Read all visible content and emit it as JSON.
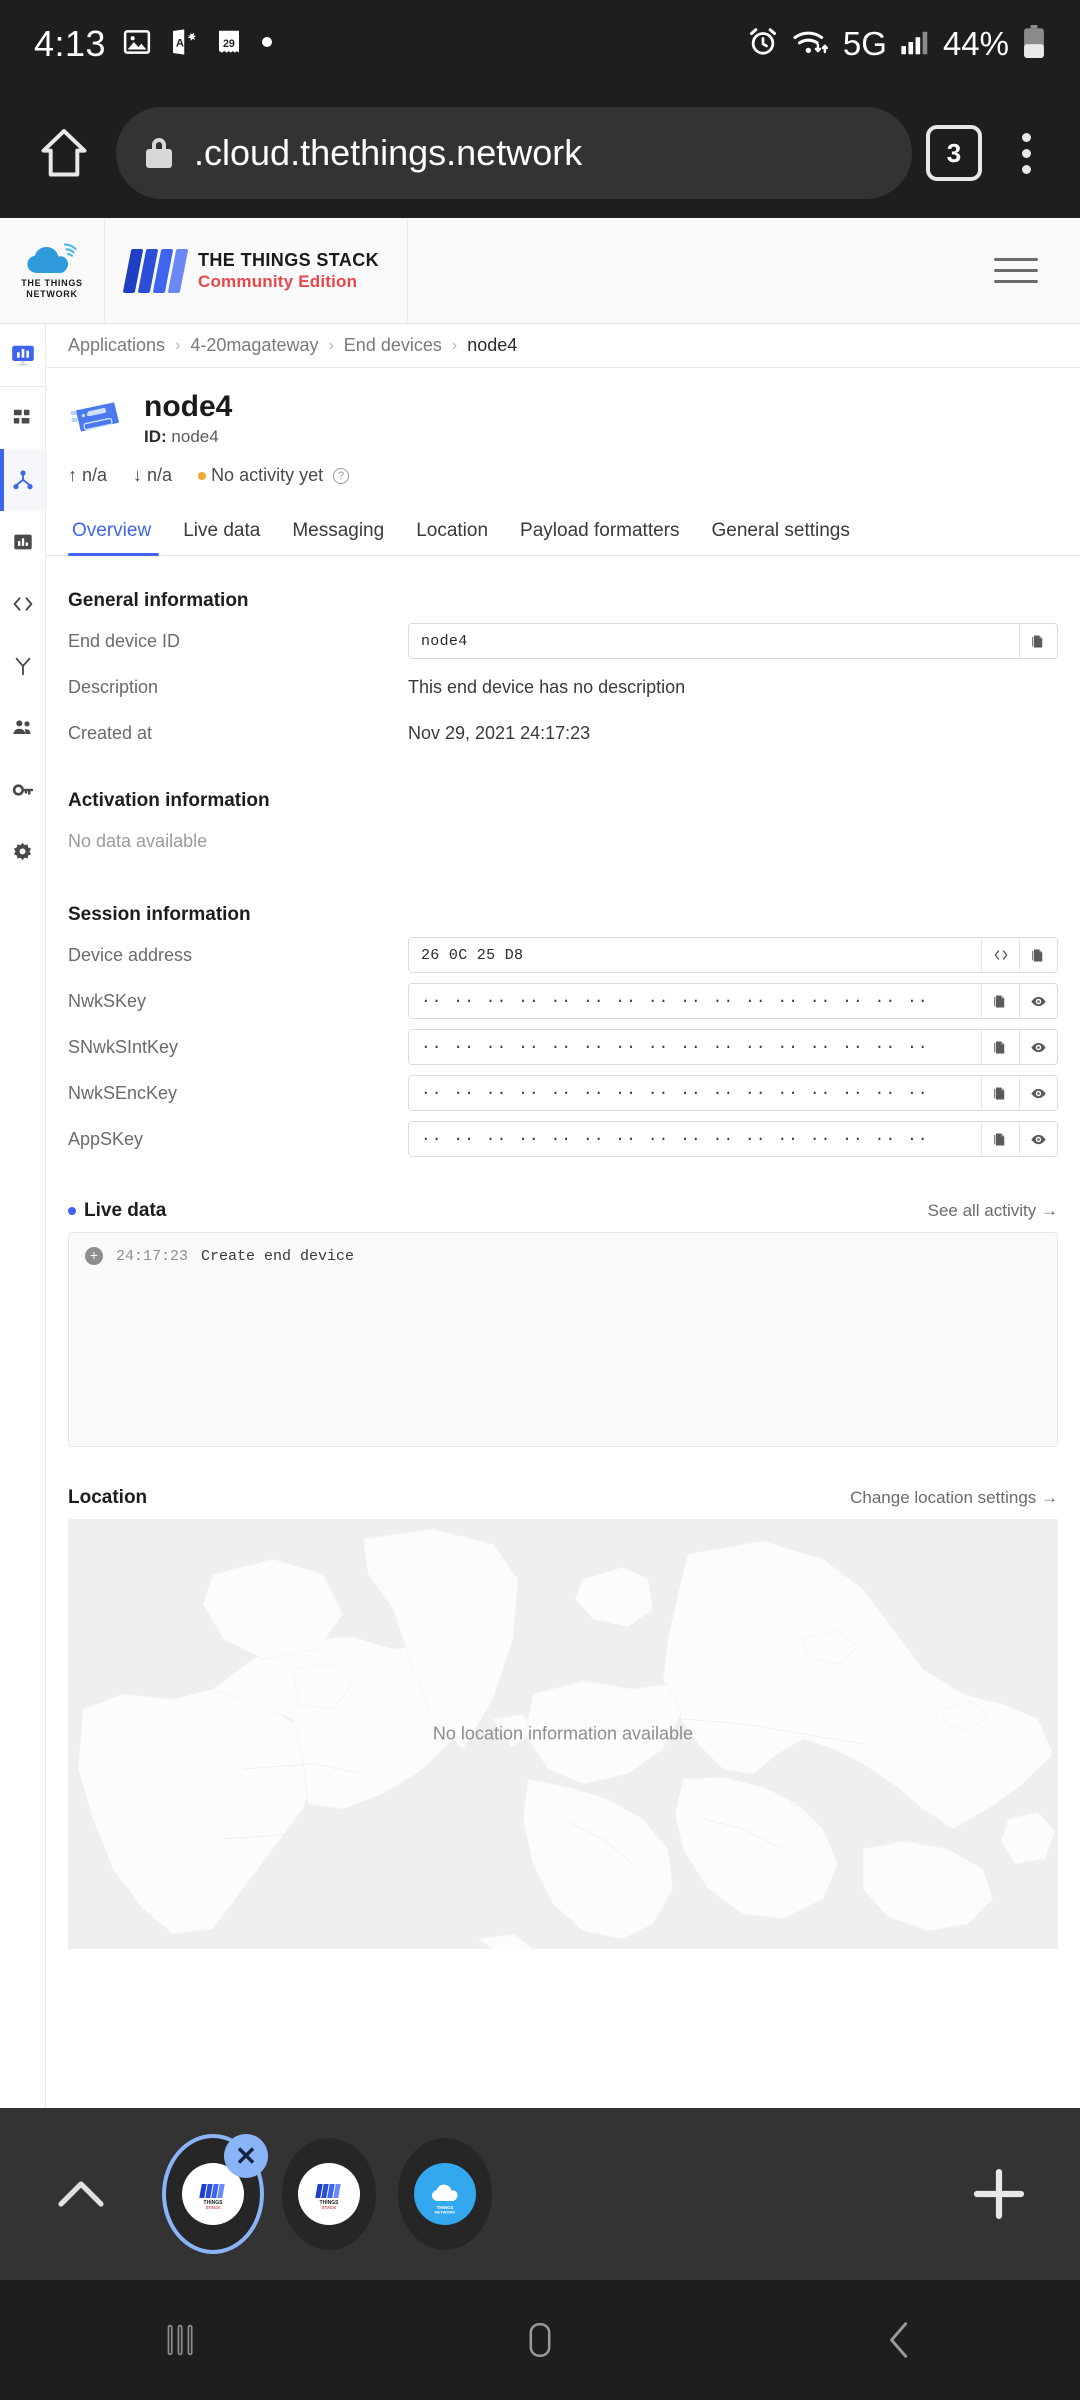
{
  "status_bar": {
    "clock": "4:13",
    "network_label": "5G",
    "battery_pct": "44%",
    "icons": [
      "photo-icon",
      "translate-icon",
      "calendar-29-icon",
      "dot-icon",
      "alarm-icon",
      "wifi-icon",
      "signal-icon",
      "battery-icon"
    ]
  },
  "browser": {
    "url": ".cloud.thethings.network",
    "tab_count": "3",
    "home_icon": "home-icon",
    "lock_icon": "lock-icon",
    "menu_icon": "kebab-menu-icon"
  },
  "app_header": {
    "ttn_wordmark_line1": "THE THINGS",
    "ttn_wordmark_line2": "NETWORK",
    "stack_title": "THE THINGS STACK",
    "stack_subtitle": "Community Edition",
    "stack_subtitle_color": "#e8474b",
    "menu_icon": "hamburger-menu-icon"
  },
  "sidebar": {
    "items": [
      {
        "name": "overview-icon",
        "active": false
      },
      {
        "name": "applications-grid-icon",
        "active": false
      },
      {
        "name": "end-devices-icon",
        "active": true
      },
      {
        "name": "live-data-icon",
        "active": false
      },
      {
        "name": "payload-formatters-icon",
        "active": false
      },
      {
        "name": "integrations-icon",
        "active": false
      },
      {
        "name": "collaborators-icon",
        "active": false
      },
      {
        "name": "api-keys-icon",
        "active": false
      },
      {
        "name": "general-settings-icon",
        "active": false
      }
    ]
  },
  "breadcrumb": {
    "items": [
      "Applications",
      "4-20magateway",
      "End devices",
      "node4"
    ],
    "separator": "›"
  },
  "device": {
    "name": "node4",
    "id_label": "ID:",
    "id_value": "node4",
    "uplink": "n/a",
    "downlink": "n/a",
    "activity": "No activity yet",
    "up_arrow": "↑",
    "down_arrow": "↓",
    "status_color": "#f0a830",
    "help_icon": "question-mark-icon"
  },
  "tabs": [
    {
      "label": "Overview",
      "active": true
    },
    {
      "label": "Live data",
      "active": false
    },
    {
      "label": "Messaging",
      "active": false
    },
    {
      "label": "Location",
      "active": false
    },
    {
      "label": "Payload formatters",
      "active": false
    },
    {
      "label": "General settings",
      "active": false
    }
  ],
  "general_information": {
    "title": "General information",
    "rows": [
      {
        "label": "End device ID",
        "value": "node4",
        "type": "field",
        "buttons": [
          "copy-icon"
        ]
      },
      {
        "label": "Description",
        "value": "This end device has no description",
        "type": "text"
      },
      {
        "label": "Created at",
        "value": "Nov 29, 2021 24:17:23",
        "type": "text"
      }
    ]
  },
  "activation_information": {
    "title": "Activation information",
    "empty_text": "No data available"
  },
  "session_information": {
    "title": "Session information",
    "rows": [
      {
        "label": "Device address",
        "value": "26 0C 25 D8",
        "masked": false,
        "buttons": [
          "code-icon",
          "copy-icon"
        ]
      },
      {
        "label": "NwkSKey",
        "value": "·· ·· ·· ·· ·· ·· ·· ·· ·· ·· ·· ·· ·· ·· ·· ··",
        "masked": true,
        "buttons": [
          "copy-icon",
          "eye-icon"
        ]
      },
      {
        "label": "SNwkSIntKey",
        "value": "·· ·· ·· ·· ·· ·· ·· ·· ·· ·· ·· ·· ·· ·· ·· ··",
        "masked": true,
        "buttons": [
          "copy-icon",
          "eye-icon"
        ]
      },
      {
        "label": "NwkSEncKey",
        "value": "·· ·· ·· ·· ·· ·· ·· ·· ·· ·· ·· ·· ·· ·· ·· ··",
        "masked": true,
        "buttons": [
          "copy-icon",
          "eye-icon"
        ]
      },
      {
        "label": "AppSKey",
        "value": "·· ·· ·· ·· ·· ·· ·· ·· ·· ·· ·· ·· ·· ·· ·· ··",
        "masked": true,
        "buttons": [
          "copy-icon",
          "eye-icon"
        ]
      }
    ]
  },
  "live_data": {
    "title": "Live data",
    "link": "See all activity →",
    "entries": [
      {
        "time": "24:17:23",
        "event": "Create end device"
      }
    ]
  },
  "location": {
    "title": "Location",
    "link": "Change location settings →",
    "empty_text": "No location information available"
  },
  "tab_strip": {
    "expand_icon": "chevron-up-icon",
    "new_tab_icon": "plus-icon",
    "close_icon": "close-x-icon",
    "tabs": [
      {
        "name": "tab-thumb-things-stack-1",
        "selected": true
      },
      {
        "name": "tab-thumb-things-stack-2",
        "selected": false
      },
      {
        "name": "tab-thumb-things-network",
        "selected": false
      }
    ]
  },
  "nav_bar": {
    "recents": "recents-icon",
    "home": "home-square-icon",
    "back": "back-chevron-icon"
  },
  "colors": {
    "accent": "#3e64f0",
    "brand_red": "#e8474b",
    "chrome_bg": "#1e1e1e",
    "url_bg": "#333333"
  }
}
